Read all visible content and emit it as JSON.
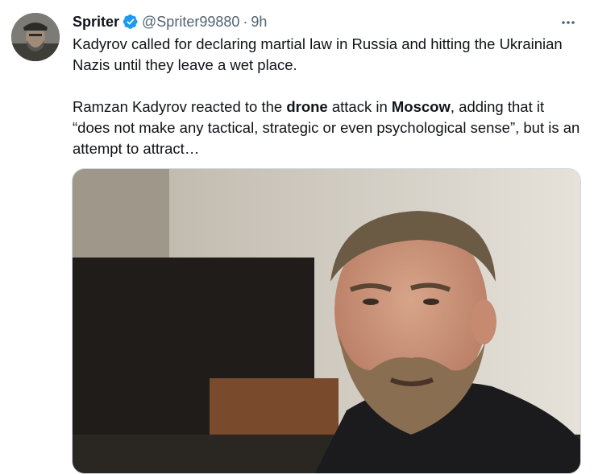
{
  "tweet": {
    "author_name": "Spriter",
    "handle": "@Spriter99880",
    "separator": "·",
    "time": "9h",
    "paragraph1": "Kadyrov called for declaring martial law in Russia and hitting the Ukrainian Nazis until they leave a wet place.",
    "p2_part1": "Ramzan Kadyrov reacted to the ",
    "p2_bold1": "drone",
    "p2_part2": " attack in ",
    "p2_bold2": "Moscow",
    "p2_part3": ", adding that it “does not make any tactical, strategic or even psychological sense”, but is an attempt to attract…",
    "verified_color": "#1d9bf0",
    "icons": {
      "verified": "verified-badge-icon",
      "more": "more-options-icon"
    }
  }
}
